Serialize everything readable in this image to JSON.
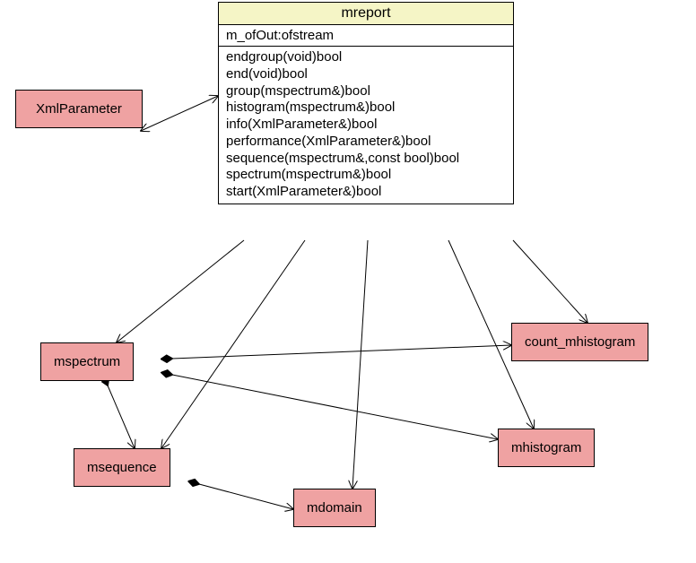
{
  "uml": {
    "name": "mreport",
    "attrs": [
      "m_ofOut:ofstream"
    ],
    "ops": [
      "endgroup(void)bool",
      "end(void)bool",
      "group(mspectrum&)bool",
      "histogram(mspectrum&)bool",
      "info(XmlParameter&)bool",
      "performance(XmlParameter&)bool",
      "sequence(mspectrum&,const bool)bool",
      "spectrum(mspectrum&)bool",
      "start(XmlParameter&)bool"
    ]
  },
  "nodes": {
    "xmlparameter": "XmlParameter",
    "mspectrum": "mspectrum",
    "msequence": "msequence",
    "mdomain": "mdomain",
    "mhistogram": "mhistogram",
    "count_mhistogram": "count_mhistogram"
  }
}
